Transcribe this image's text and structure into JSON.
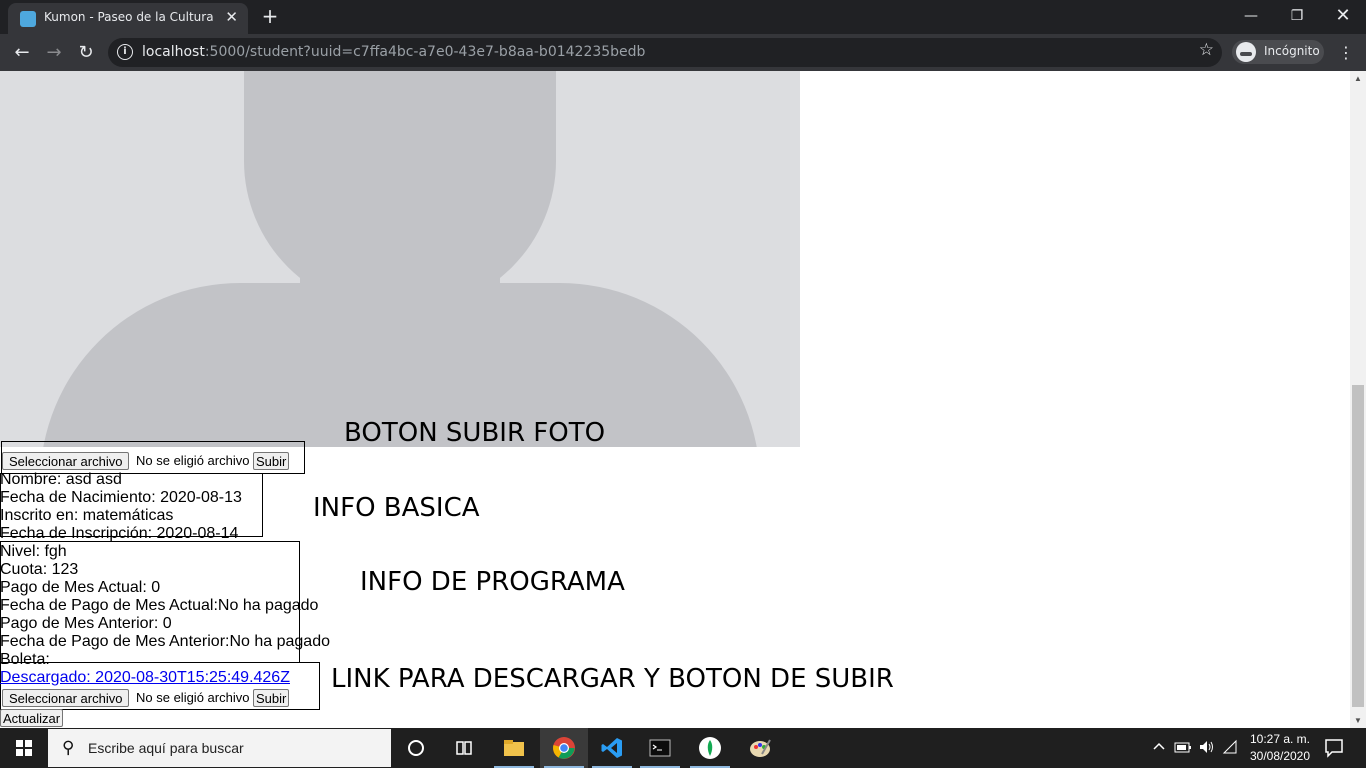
{
  "browser": {
    "tab_title": "Kumon - Paseo de la Cultura",
    "tab_close": "✕",
    "new_tab": "+",
    "url_host": "localhost",
    "url_rest": ":5000/student?uuid=c7ffa4bc-a7e0-43e7-b8aa-b0142235bedb",
    "incognito_label": "Incógnito",
    "window_controls": {
      "minimize": "—",
      "maximize": "❐",
      "close": "✕"
    },
    "nav": {
      "back": "←",
      "forward": "→",
      "reload": "↻"
    },
    "info_glyph": "i",
    "star_glyph": "☆",
    "menu_glyph": "⋮"
  },
  "annotations": {
    "photo": "BOTON SUBIR FOTO",
    "basic": "INFO BASICA",
    "program": "INFO DE PROGRAMA",
    "download": "LINK PARA DESCARGAR Y BOTON DE SUBIR"
  },
  "photo_upload": {
    "choose_label": "Seleccionar archivo",
    "no_file": "No se eligió archivo",
    "submit": "Subir"
  },
  "basic_info": {
    "nombre": "Nombre: asd asd",
    "fecha_nacimiento": "Fecha de Nacimiento: 2020-08-13",
    "inscrito": "Inscrito en: matemáticas",
    "fecha_inscripcion": "Fecha de Inscripción: 2020-08-14"
  },
  "program_info": {
    "nivel": "Nivel: fgh",
    "cuota": "Cuota: 123",
    "pago_actual": "Pago de Mes Actual: 0",
    "fecha_pago_actual": "Fecha de Pago de Mes Actual:No ha pagado",
    "pago_anterior": "Pago de Mes Anterior: 0",
    "fecha_pago_anterior": "Fecha de Pago de Mes Anterior:No ha pagado"
  },
  "boleta": {
    "label": "Boleta:",
    "link": "Descargado: 2020-08-30T15:25:49.426Z",
    "choose_label": "Seleccionar archivo",
    "no_file": "No se eligió archivo",
    "submit": "Subir"
  },
  "update_button": "Actualizar",
  "taskbar": {
    "search_placeholder": "Escribe aquí para buscar",
    "time": "10:27 a. m.",
    "date": "30/08/2020",
    "apps": [
      "cortana-icon",
      "task-view-icon",
      "file-explorer-icon",
      "chrome-icon",
      "vscode-icon",
      "terminal-icon",
      "mongodb-icon",
      "paint-icon"
    ]
  }
}
